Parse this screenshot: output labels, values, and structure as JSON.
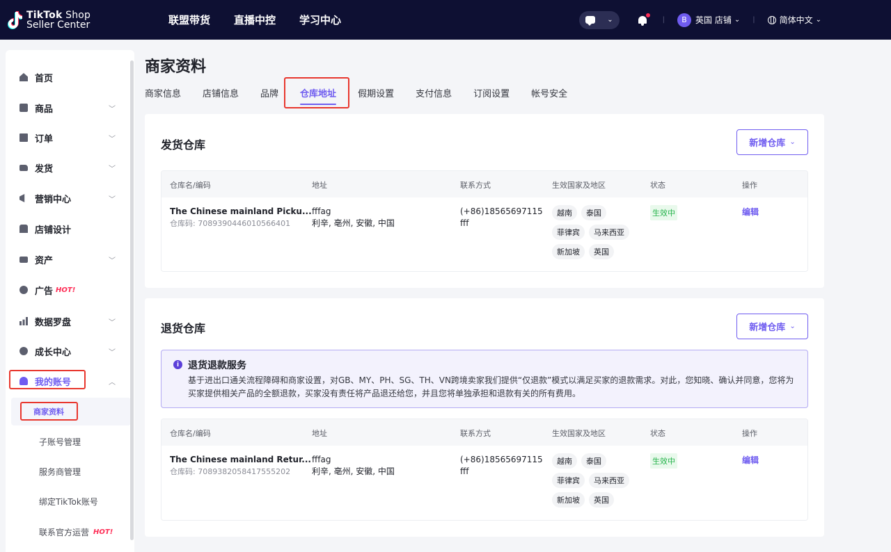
{
  "header": {
    "logo_line1": "TikTok",
    "logo_line1b": " Shop",
    "logo_line2": "Seller Center",
    "nav": [
      "联盟带货",
      "直播中控",
      "学习中心"
    ],
    "store_avatar": "B",
    "store_label": "英国 店铺",
    "language": "简体中文"
  },
  "sidebar": {
    "items": [
      {
        "label": "首页",
        "icon": "home-icon"
      },
      {
        "label": "商品",
        "icon": "product-icon"
      },
      {
        "label": "订单",
        "icon": "order-icon"
      },
      {
        "label": "发货",
        "icon": "shipping-icon"
      },
      {
        "label": "营销中心",
        "icon": "megaphone-icon"
      },
      {
        "label": "店铺设计",
        "icon": "shop-icon"
      },
      {
        "label": "资产",
        "icon": "card-icon"
      },
      {
        "label": "广告",
        "icon": "ad-icon",
        "hot": "HOT!"
      },
      {
        "label": "数据罗盘",
        "icon": "chart-icon"
      },
      {
        "label": "成长中心",
        "icon": "medal-icon"
      },
      {
        "label": "我的账号",
        "icon": "user-icon"
      }
    ],
    "sub_items": [
      {
        "label": "商家资料"
      },
      {
        "label": "子账号管理"
      },
      {
        "label": "服务商管理"
      },
      {
        "label": "绑定TikTok账号"
      },
      {
        "label": "联系官方运营",
        "hot": "HOT!"
      }
    ]
  },
  "page": {
    "title": "商家资料",
    "tabs": [
      "商家信息",
      "店铺信息",
      "品牌",
      "仓库地址",
      "假期设置",
      "支付信息",
      "订阅设置",
      "帐号安全"
    ],
    "active_tab": "仓库地址"
  },
  "shipping": {
    "title": "发货仓库",
    "add_button": "新增仓库",
    "columns": [
      "仓库名/编码",
      "地址",
      "联系方式",
      "生效国家及地区",
      "状态",
      "操作"
    ],
    "row": {
      "name": "The Chinese mainland Picku...",
      "code": "仓库码: 7089390446010566401",
      "addr1": "fffag",
      "addr2": "利辛, 亳州, 安徽, 中国",
      "phone": "(+86)18565697115",
      "contact": "fff",
      "regions": [
        "越南",
        "泰国",
        "菲律宾",
        "马来西亚",
        "新加坡",
        "英国"
      ],
      "status": "生效中",
      "action": "编辑"
    }
  },
  "returns": {
    "title": "退货仓库",
    "add_button": "新增仓库",
    "notice_title": "退货退款服务",
    "notice_body": "基于进出口通关流程障碍和商家设置，对GB、MY、PH、SG、TH、VN跨境卖家我们提供“仅退款”模式以满足买家的退款需求。对此，您知晓、确认并同意，您将为买家提供相关产品的全额退款，买家没有责任将产品退还给您，并且您将单独承担和退款有关的所有费用。",
    "columns": [
      "仓库名/编码",
      "地址",
      "联系方式",
      "生效国家及地区",
      "状态",
      "操作"
    ],
    "row": {
      "name": "The Chinese mainland Retur...",
      "code": "仓库码: 7089382058417555202",
      "addr1": "fffag",
      "addr2": "利辛, 亳州, 安徽, 中国",
      "phone": "(+86)18565697115",
      "contact": "fff",
      "regions": [
        "越南",
        "泰国",
        "菲律宾",
        "马来西亚",
        "新加坡",
        "英国"
      ],
      "status": "生效中",
      "action": "编辑"
    }
  },
  "colors": {
    "accent": "#6f5cf0",
    "topbar": "#0e1033",
    "highlight": "#e8362d",
    "status_green": "#25b34b"
  }
}
